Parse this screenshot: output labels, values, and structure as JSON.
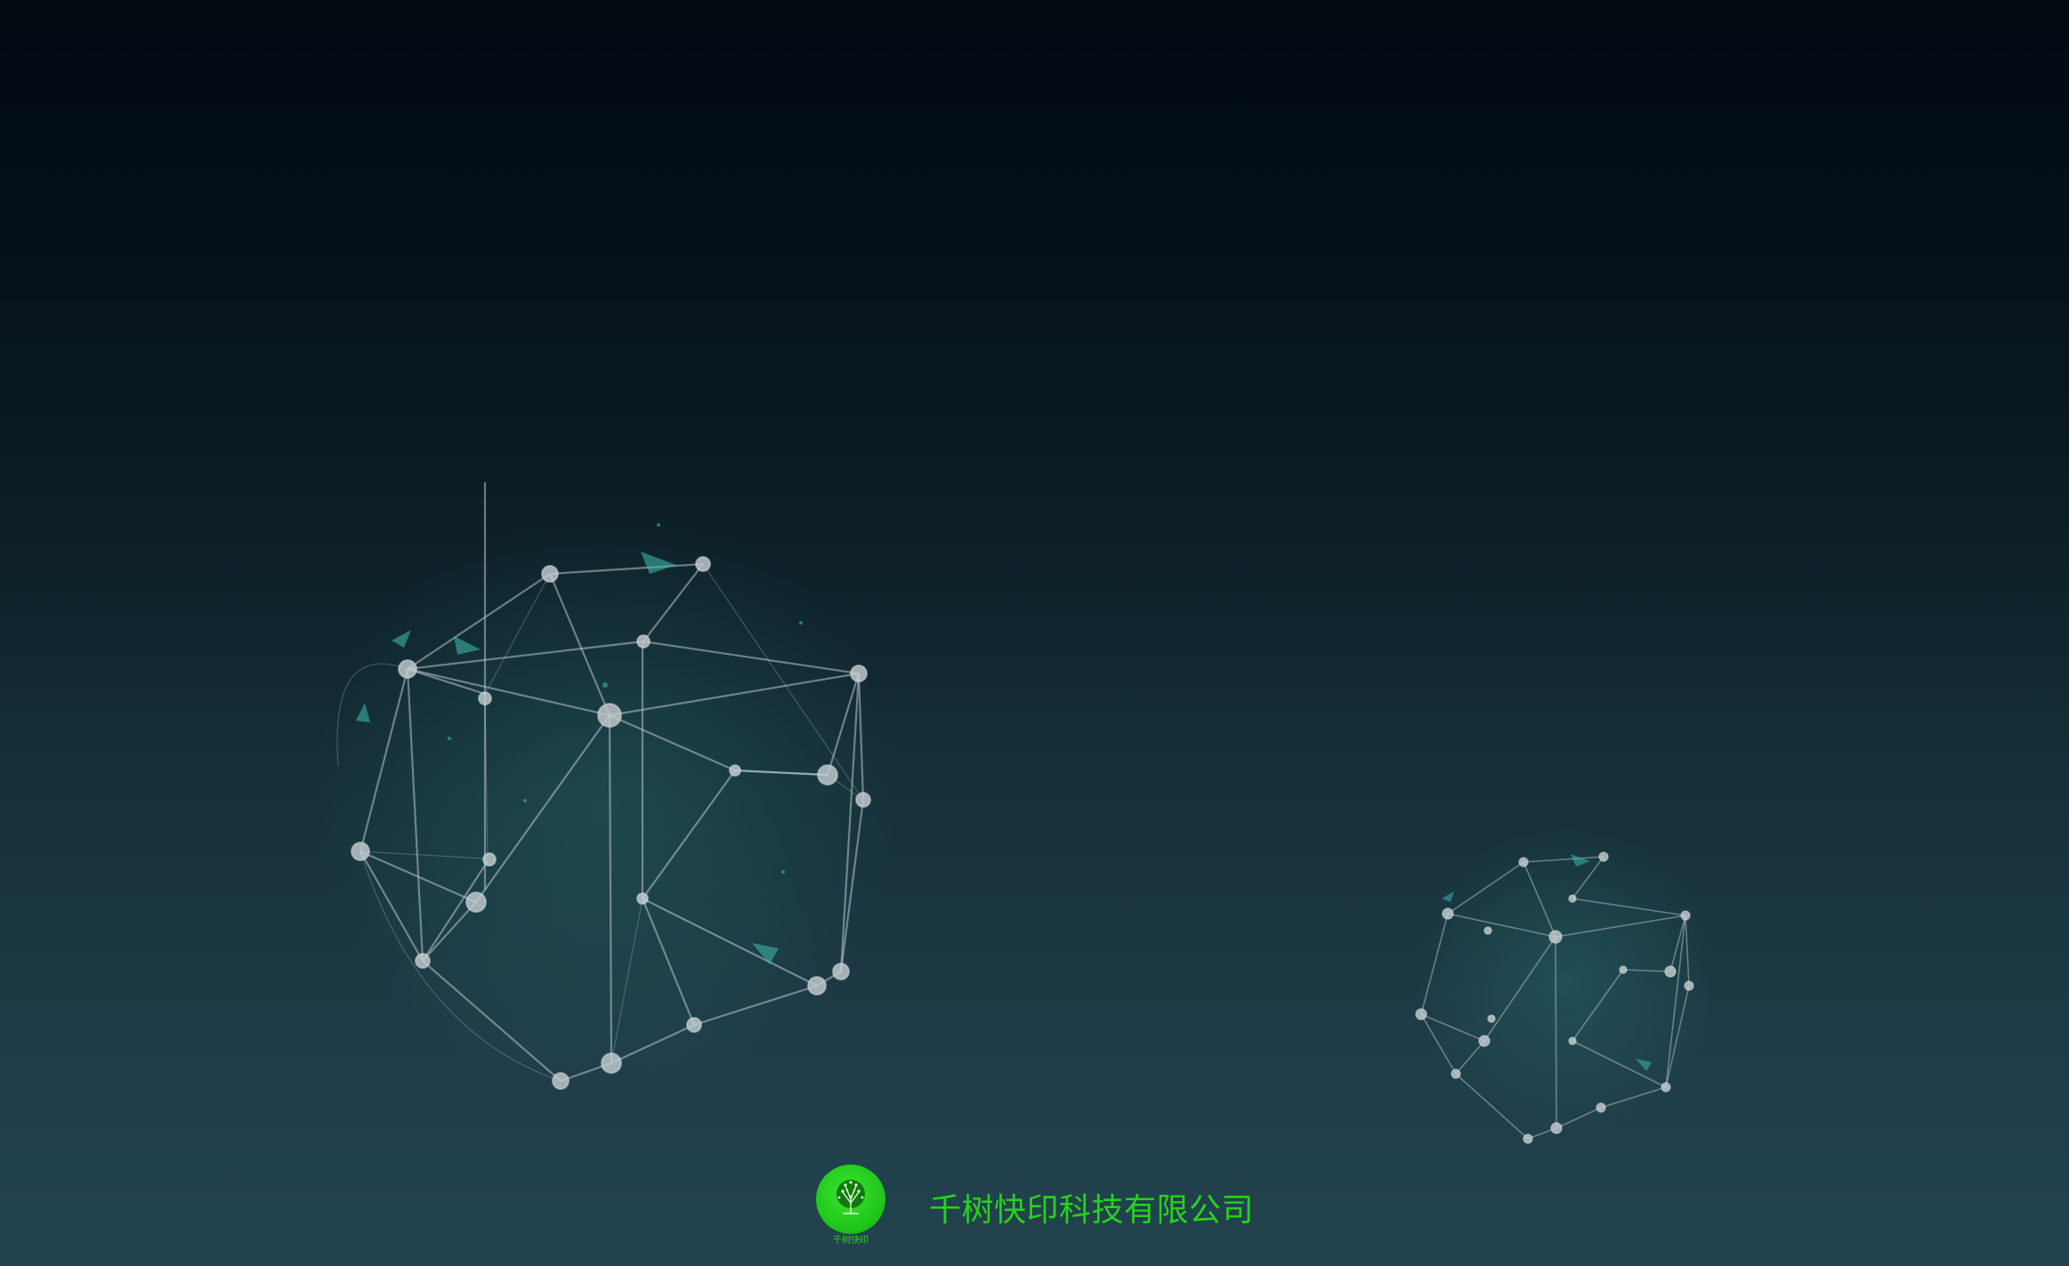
{
  "background": {
    "gradient_top": "#020a12",
    "gradient_bottom": "#22434e",
    "network_line_color": "#b8c4c8",
    "network_node_color": "#c7d0d3",
    "particle_accent": "#3fbfb0"
  },
  "footer": {
    "logo_icon": "tree-icon",
    "logo_color": "#22c81c",
    "logo_caption": "千树快印",
    "company_name": "千树快印科技有限公司",
    "text_color": "#27d11e"
  }
}
